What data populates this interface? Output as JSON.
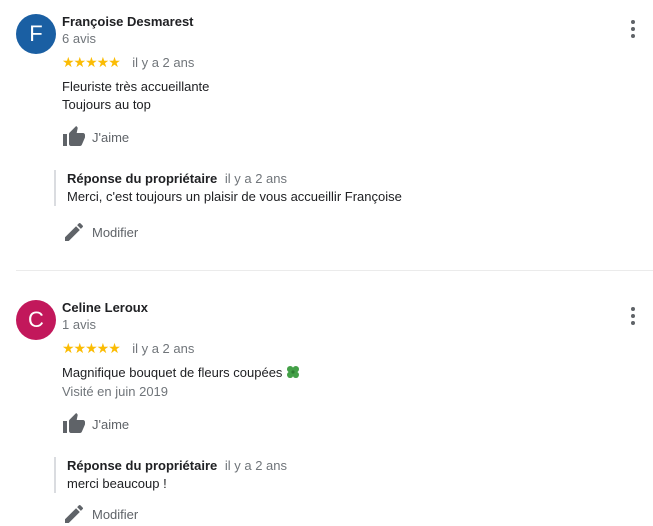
{
  "reviews": [
    {
      "avatar_letter": "F",
      "avatar_color": "#1a5fa3",
      "author": "Françoise Desmarest",
      "review_count": "6 avis",
      "rating": 5,
      "stars": "★★★★★",
      "age": "il y a 2 ans",
      "text_lines": [
        "Fleuriste très accueillante",
        "Toujours au top"
      ],
      "like_label": "J'aime",
      "reply": {
        "title": "Réponse du propriétaire",
        "age": "il y a 2 ans",
        "text": "Merci, c'est toujours un plaisir de vous accueillir Françoise"
      },
      "edit_label": "Modifier"
    },
    {
      "avatar_letter": "C",
      "avatar_color": "#c2185b",
      "author": "Celine Leroux",
      "review_count": "1 avis",
      "rating": 5,
      "stars": "★★★★★",
      "age": "il y a 2 ans",
      "text_lines": [
        "Magnifique bouquet de fleurs coupées"
      ],
      "emoji": "four-leaf-clover-icon",
      "visited": "Visité en juin 2019",
      "like_label": "J'aime",
      "reply": {
        "title": "Réponse du propriétaire",
        "age": "il y a 2 ans",
        "text": "merci beaucoup !"
      },
      "edit_label": "Modifier"
    }
  ],
  "colors": {
    "star": "#fbbc04",
    "secondary_text": "#70757a",
    "icon": "#5f6368"
  }
}
